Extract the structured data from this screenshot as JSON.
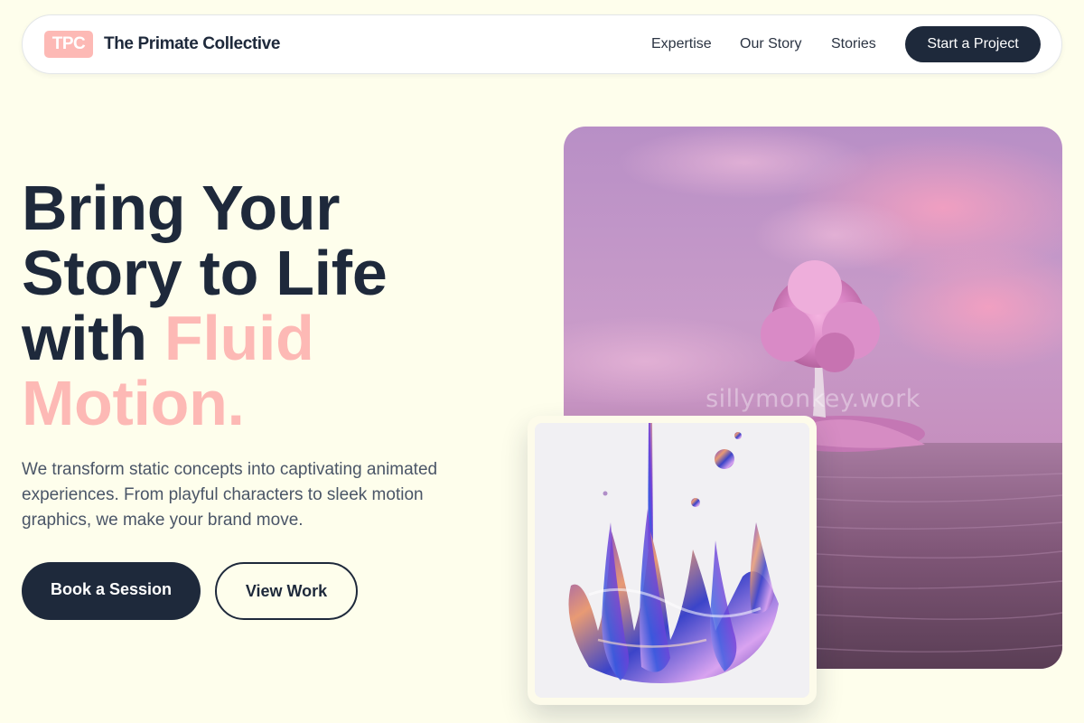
{
  "header": {
    "logo_text": "TPC",
    "brand_name": "The Primate Collective",
    "nav": [
      "Expertise",
      "Our Story",
      "Stories"
    ],
    "cta_label": "Start a Project"
  },
  "hero": {
    "title_line1": "Bring Your",
    "title_line2": "Story to Life",
    "title_line3_prefix": "with ",
    "title_accent1": "Fluid",
    "title_accent2": "Motion.",
    "description": "We transform static concepts into captivating animated experiences. From playful characters to sleek motion graphics, we make your brand move.",
    "primary_button": "Book a Session",
    "secondary_button": "View Work"
  },
  "media": {
    "watermark": "sillymonkey.work",
    "main_image_subject": "pink-tree-lake-landscape",
    "card_image_subject": "iridescent-liquid-splash"
  },
  "colors": {
    "background": "#fefeec",
    "navy": "#1e293b",
    "accent_pink": "#fdb9b5",
    "body_text": "#4a5567"
  }
}
